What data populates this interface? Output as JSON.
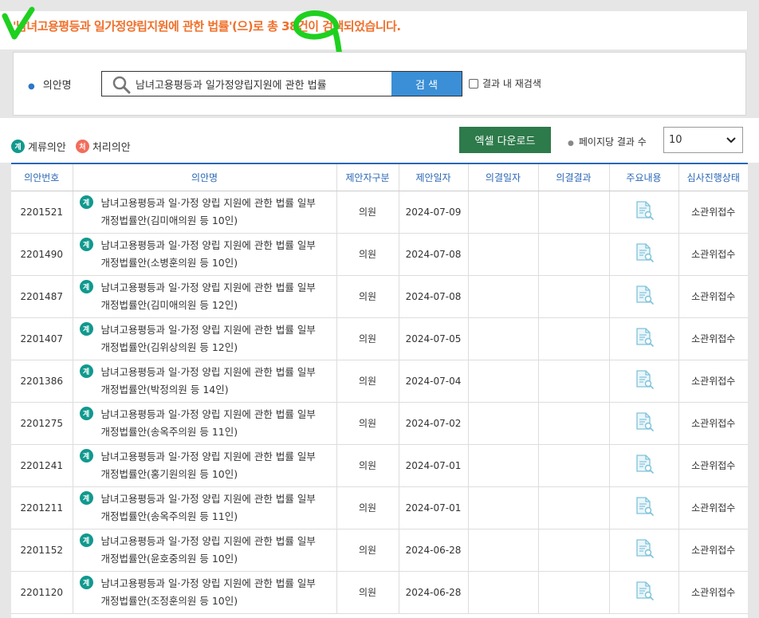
{
  "banner": {
    "prefix": "'남녀고용평등과 일가정양립지원에 관한 법률'(으)로 총 ",
    "count": "38",
    "suffix": "건이 검색되었습니다."
  },
  "search": {
    "label": "의안명",
    "value": "남녀고용평등과 일가정양립지원에 관한 법률",
    "button": "검 색",
    "within_label": "결과 내 재검색"
  },
  "legend": {
    "pending_badge": "계",
    "pending_label": "계류의안",
    "done_badge": "처",
    "done_label": "처리의안"
  },
  "toolbar": {
    "excel_button": "엑셀 다운로드",
    "per_page_label": "페이지당 결과 수",
    "per_page_value": "10"
  },
  "table": {
    "headers": [
      "의안번호",
      "의안명",
      "제안자구분",
      "제안일자",
      "의결일자",
      "의결결과",
      "주요내용",
      "심사진행상태"
    ],
    "rows": [
      {
        "no": "2201521",
        "title_line1": "남녀고용평등과 일·가정 양립 지원에 관한 법률 일부",
        "title_line2": "개정법률안(김미애의원 등 10인)",
        "proposer": "의원",
        "date": "2024-07-09",
        "vote_date": "",
        "result": "",
        "status": "소관위접수"
      },
      {
        "no": "2201490",
        "title_line1": "남녀고용평등과 일·가정 양립 지원에 관한 법률 일부",
        "title_line2": "개정법률안(소병훈의원 등 10인)",
        "proposer": "의원",
        "date": "2024-07-08",
        "vote_date": "",
        "result": "",
        "status": "소관위접수"
      },
      {
        "no": "2201487",
        "title_line1": "남녀고용평등과 일·가정 양립 지원에 관한 법률 일부",
        "title_line2": "개정법률안(김미애의원 등 12인)",
        "proposer": "의원",
        "date": "2024-07-08",
        "vote_date": "",
        "result": "",
        "status": "소관위접수"
      },
      {
        "no": "2201407",
        "title_line1": "남녀고용평등과 일·가정 양립 지원에 관한 법률 일부",
        "title_line2": "개정법률안(김위상의원 등 12인)",
        "proposer": "의원",
        "date": "2024-07-05",
        "vote_date": "",
        "result": "",
        "status": "소관위접수"
      },
      {
        "no": "2201386",
        "title_line1": "남녀고용평등과 일·가정 양립 지원에 관한 법률 일부",
        "title_line2": "개정법률안(박정의원 등 14인)",
        "proposer": "의원",
        "date": "2024-07-04",
        "vote_date": "",
        "result": "",
        "status": "소관위접수"
      },
      {
        "no": "2201275",
        "title_line1": "남녀고용평등과 일·가정 양립 지원에 관한 법률 일부",
        "title_line2": "개정법률안(송옥주의원 등 11인)",
        "proposer": "의원",
        "date": "2024-07-02",
        "vote_date": "",
        "result": "",
        "status": "소관위접수"
      },
      {
        "no": "2201241",
        "title_line1": "남녀고용평등과 일·가정 양립 지원에 관한 법률 일부",
        "title_line2": "개정법률안(홍기원의원 등 10인)",
        "proposer": "의원",
        "date": "2024-07-01",
        "vote_date": "",
        "result": "",
        "status": "소관위접수"
      },
      {
        "no": "2201211",
        "title_line1": "남녀고용평등과 일·가정 양립 지원에 관한 법률 일부",
        "title_line2": "개정법률안(송옥주의원 등 11인)",
        "proposer": "의원",
        "date": "2024-07-01",
        "vote_date": "",
        "result": "",
        "status": "소관위접수"
      },
      {
        "no": "2201152",
        "title_line1": "남녀고용평등과 일·가정 양립 지원에 관한 법률 일부",
        "title_line2": "개정법률안(윤호중의원 등 10인)",
        "proposer": "의원",
        "date": "2024-06-28",
        "vote_date": "",
        "result": "",
        "status": "소관위접수"
      },
      {
        "no": "2201120",
        "title_line1": "남녀고용평등과 일·가정 양립 지원에 관한 법률 일부",
        "title_line2": "개정법률안(조정훈의원 등 10인)",
        "proposer": "의원",
        "date": "2024-06-28",
        "vote_date": "",
        "result": "",
        "status": "소관위접수"
      }
    ]
  },
  "colors": {
    "accent_orange": "#f0702b",
    "header_blue": "#2b67b5",
    "search_button": "#3b8fd6",
    "excel_green": "#2d7a4a",
    "pending_badge": "#11998e",
    "done_badge": "#f26d5b",
    "annotation_green": "#1fd01f"
  },
  "icons": {
    "search": "magnifier-icon",
    "summary": "document-search-icon",
    "dropdown": "chevron-down-icon"
  }
}
